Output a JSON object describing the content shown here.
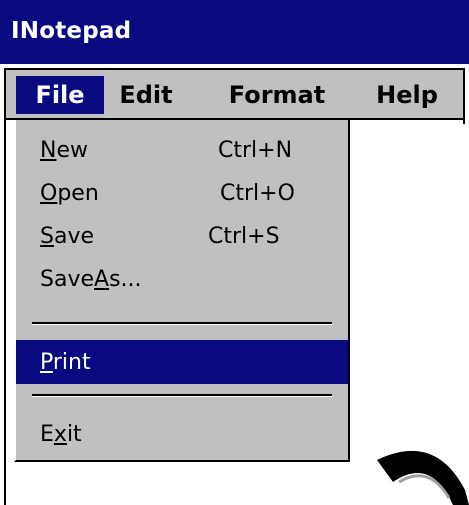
{
  "window": {
    "title": "INotepad"
  },
  "menubar": {
    "items": [
      {
        "label": "File",
        "active": true
      },
      {
        "label": "Edit",
        "active": false
      },
      {
        "label": "Format",
        "active": false
      },
      {
        "label": "Help",
        "active": false
      }
    ]
  },
  "file_menu": {
    "items": [
      {
        "pre": "",
        "mnemonic": "N",
        "post": "ew",
        "shortcut": "Ctrl+N"
      },
      {
        "pre": "",
        "mnemonic": "O",
        "post": "pen",
        "shortcut": "Ctrl+O"
      },
      {
        "pre": "",
        "mnemonic": "S",
        "post": "ave",
        "shortcut": "Ctrl+S"
      },
      {
        "pre": "Save",
        "mnemonic": "A",
        "post": "s...",
        "shortcut": ""
      },
      {
        "pre": "",
        "mnemonic": "P",
        "post": "rint",
        "shortcut": "",
        "highlighted": true
      },
      {
        "pre": "E",
        "mnemonic": "x",
        "post": "it",
        "shortcut": ""
      }
    ]
  },
  "colors": {
    "title_bar": "#0a0a80",
    "menu_background": "#c0c0c0",
    "highlight": "#0a0a80"
  },
  "icons": {
    "cursor": "busy-spinner-icon"
  }
}
